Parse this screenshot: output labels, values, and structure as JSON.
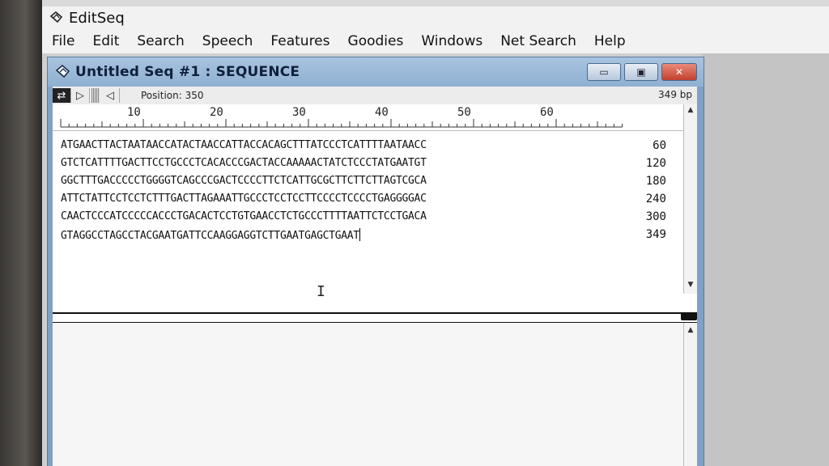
{
  "app": {
    "title": "EditSeq",
    "menu": [
      "File",
      "Edit",
      "Search",
      "Speech",
      "Features",
      "Goodies",
      "Windows",
      "Net Search",
      "Help"
    ]
  },
  "document": {
    "title": "Untitled Seq #1 : SEQUENCE",
    "toolbar": {
      "position_label": "Position: 350",
      "length_label": "349 bp"
    },
    "ruler": [
      "10",
      "20",
      "30",
      "40",
      "50",
      "60"
    ],
    "sequence_lines": [
      {
        "text": "ATGAACTTACTAATAACCATACTAACCATTACCACAGCTTTATCCCTCATTTTAATAACC",
        "count": "60"
      },
      {
        "text": "GTCTCATTTTGACTTCCTGCCCTCACACCCGACTACCAAAAACTATCTCCCTATGAATGT",
        "count": "120"
      },
      {
        "text": "GGCTTTGACCCCCTGGGGTCAGCCCGACTCCCCTTCTCATTGCGCTTCTTCTTAGTCGCA",
        "count": "180"
      },
      {
        "text": "ATTCTATTCCTCCTCTTTGACTTAGAAATTGCCCTCCTCCTTCCCCTCCCCTGAGGGGAC",
        "count": "240"
      },
      {
        "text": "CAACTCCCATCCCCCACCCTGACACTCCTGTGAACCTCTGCCCTTTTAATTCTCCTGACA",
        "count": "300"
      },
      {
        "text": "GTAGGCCTAGCCTACGAATGATTCCAAGGAGGTCTTGAATGAGCTGAAT",
        "count": "349"
      }
    ]
  },
  "colors": {
    "window_frame": "#7ea1c6",
    "close_button": "#c2402c"
  }
}
